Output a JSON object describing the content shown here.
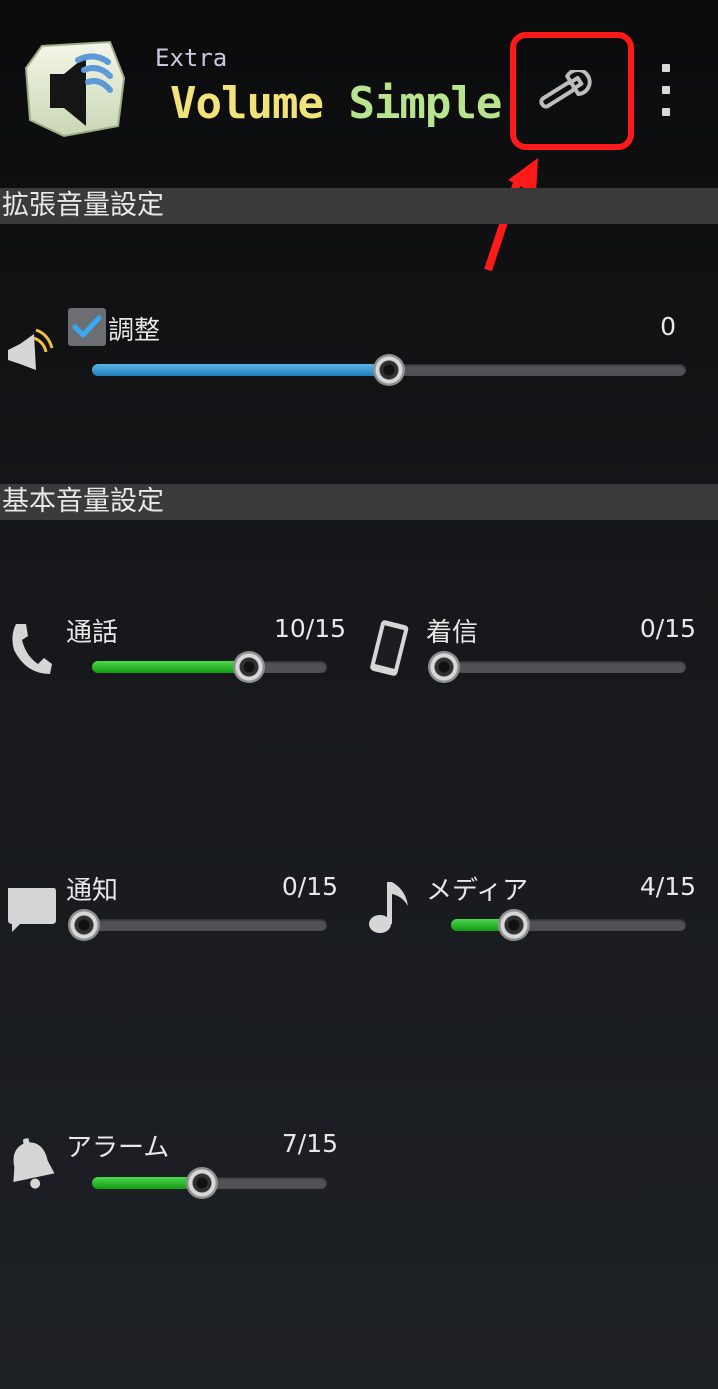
{
  "header": {
    "brand_extra": "Extra",
    "brand_volume": "Volume",
    "brand_simple": "Simple",
    "settings_icon": "wrench-icon",
    "overflow_icon": "more-vert-icon",
    "highlight_color": "#ff1a1a"
  },
  "extended_section": {
    "title": "拡張音量設定",
    "adjust": {
      "icon": "speaker-icon",
      "checkbox_checked": true,
      "label": "調整",
      "value": "0",
      "fill_fraction": 0.5
    }
  },
  "basic_section": {
    "title": "基本音量設定",
    "call": {
      "icon": "phone-icon",
      "label": "通話",
      "value": "10/15",
      "fill_fraction": 0.6667
    },
    "ringtone": {
      "icon": "smartphone-icon",
      "label": "着信",
      "value": "0/15",
      "fill_fraction": 0
    },
    "notification": {
      "icon": "chat-bubble-icon",
      "label": "通知",
      "value": "0/15",
      "fill_fraction": 0
    },
    "media": {
      "icon": "music-note-icon",
      "label": "メディア",
      "value": "4/15",
      "fill_fraction": 0.2667
    },
    "alarm": {
      "icon": "bell-icon",
      "label": "アラーム",
      "value": "7/15",
      "fill_fraction": 0.4667
    }
  },
  "colors": {
    "accent_blue": "#1f7fb9",
    "accent_green": "#139a13",
    "section_bg": "#3a3a3a"
  }
}
